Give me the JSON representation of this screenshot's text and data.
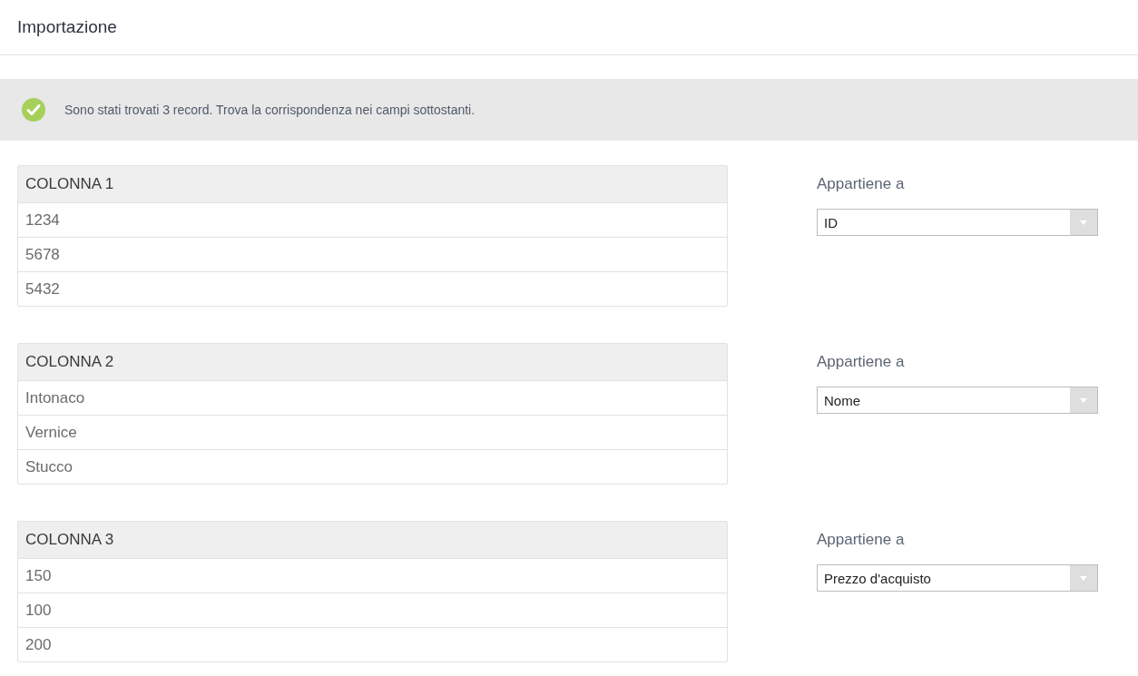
{
  "header": {
    "title": "Importazione"
  },
  "notice": {
    "text": "Sono stati trovati 3 record. Trova la corrispondenza nei campi sottostanti."
  },
  "columns": [
    {
      "heading": "COLONNA 1",
      "values": [
        "1234",
        "5678",
        "5432"
      ],
      "label": "Appartiene a",
      "select": "ID"
    },
    {
      "heading": "COLONNA 2",
      "values": [
        "Intonaco",
        "Vernice",
        "Stucco"
      ],
      "label": "Appartiene a",
      "select": "Nome"
    },
    {
      "heading": "COLONNA 3",
      "values": [
        "150",
        "100",
        "200"
      ],
      "label": "Appartiene a",
      "select": "Prezzo d'acquisto"
    }
  ]
}
